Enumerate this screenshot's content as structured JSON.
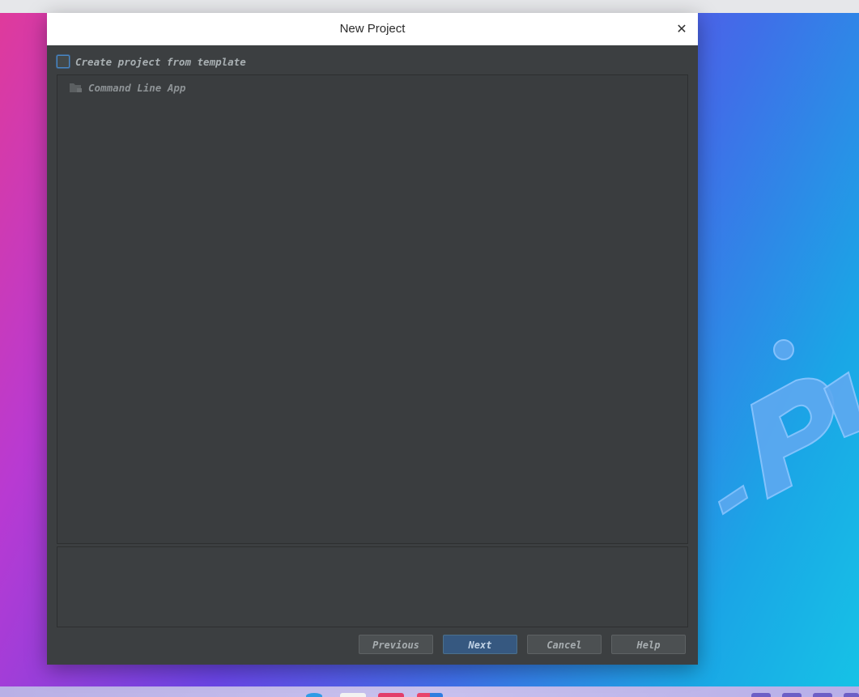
{
  "dialog": {
    "title": "New Project",
    "close_label": "✕"
  },
  "template_option": {
    "label": "Create project from template",
    "checked": false
  },
  "templates": [
    {
      "label": "Command Line App"
    }
  ],
  "buttons": {
    "previous": "Previous",
    "next": "Next",
    "cancel": "Cancel",
    "help": "Help"
  },
  "colors": {
    "dialog_bg": "#3c3f41",
    "primary_button": "#365880",
    "checkbox_border": "#4a88c7"
  }
}
